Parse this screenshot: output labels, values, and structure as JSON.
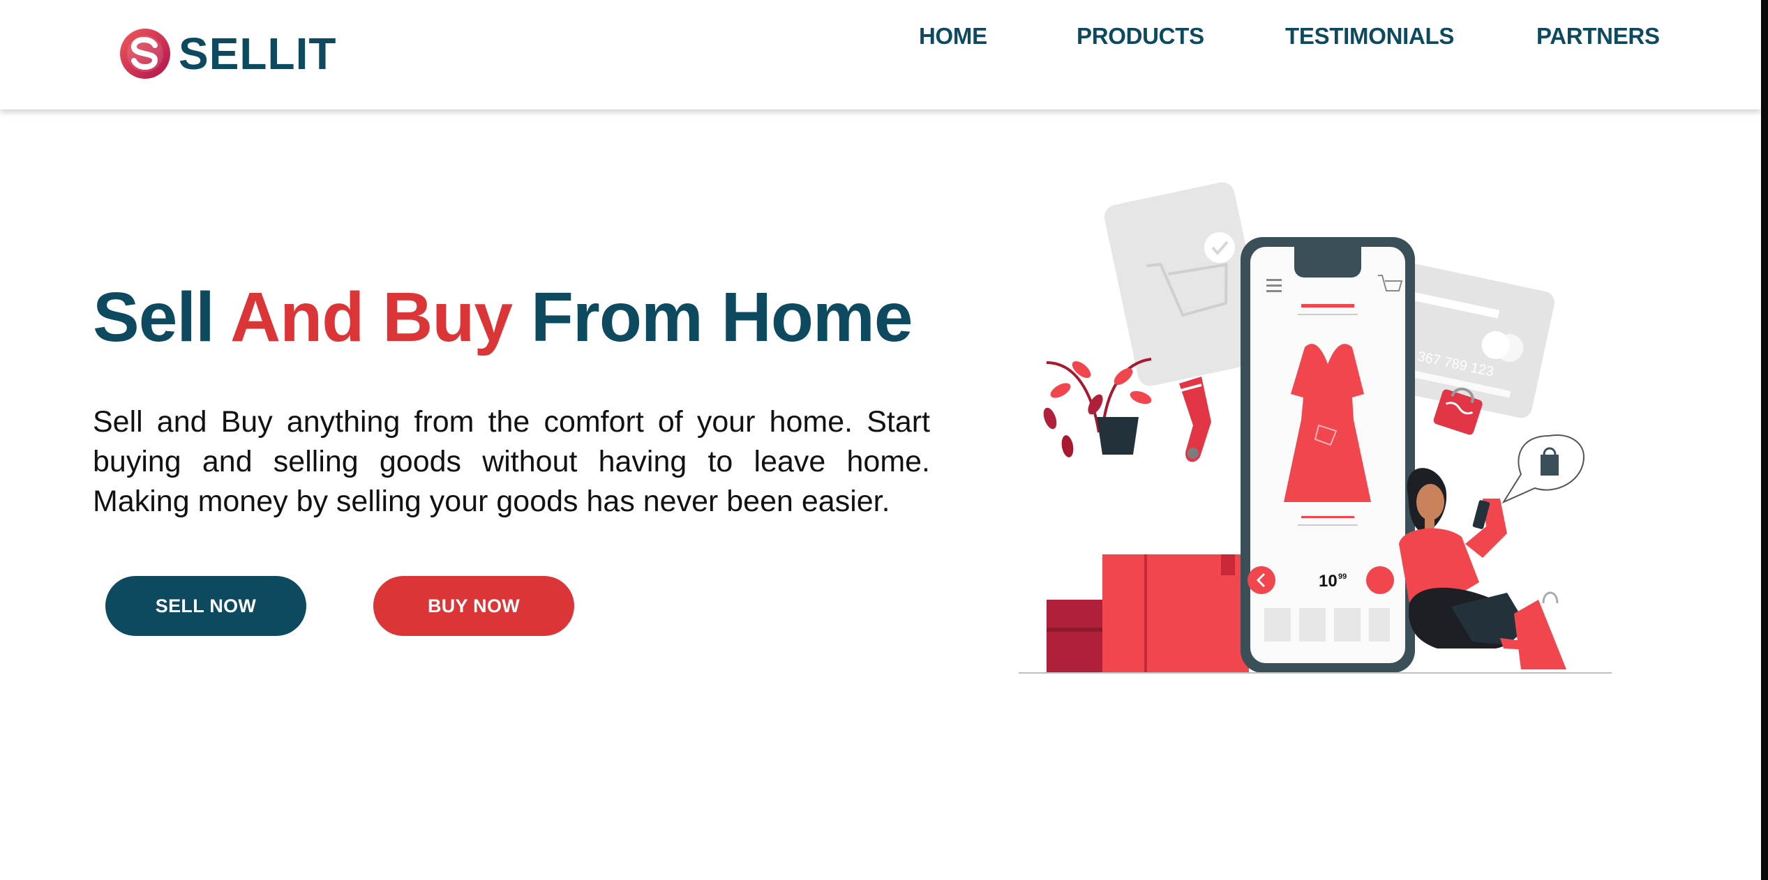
{
  "brand": {
    "name": "SELLIT",
    "logo_icon": "s-logo-icon"
  },
  "nav": [
    {
      "label": "HOME"
    },
    {
      "label": "PRODUCTS"
    },
    {
      "label": "TESTIMONIALS"
    },
    {
      "label": "PARTNERS"
    }
  ],
  "hero": {
    "title_part1": "Sell ",
    "title_accent": "And Buy",
    "title_part2": " From Home",
    "description": "Sell and Buy anything from the comfort of your home. Start buying and selling goods without having to leave home. Making money by selling your goods has never been easier.",
    "sell_button": "SELL NOW",
    "buy_button": "BUY NOW",
    "illustration": {
      "price": "10",
      "price_cents": "99",
      "card_number": "456 367 789 123"
    }
  },
  "colors": {
    "primary": "#0d4a5f",
    "accent": "#dc3538",
    "illustration_red": "#f2464f",
    "illustration_gray": "#e6e6e6"
  }
}
